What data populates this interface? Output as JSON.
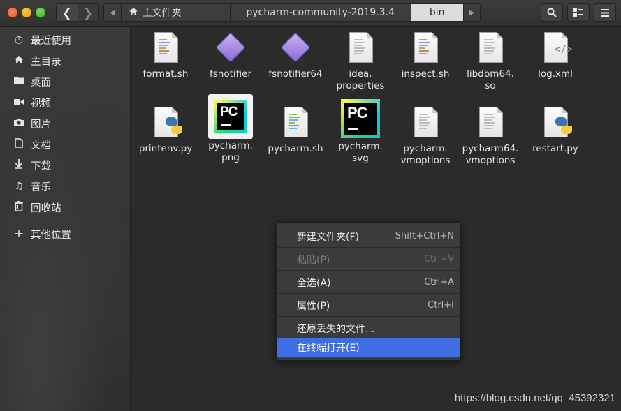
{
  "window": {
    "title": "bin"
  },
  "header": {
    "path_segments": [
      "主文件夹",
      "pycharm-community-2019.3.4",
      "bin"
    ],
    "active_segment": "bin"
  },
  "sidebar": {
    "items": [
      {
        "label": "最近使用",
        "icon": "clock-icon"
      },
      {
        "label": "主目录",
        "icon": "home-icon"
      },
      {
        "label": "桌面",
        "icon": "folder-icon"
      },
      {
        "label": "视频",
        "icon": "video-icon"
      },
      {
        "label": "图片",
        "icon": "camera-icon"
      },
      {
        "label": "文档",
        "icon": "document-icon"
      },
      {
        "label": "下载",
        "icon": "download-icon"
      },
      {
        "label": "音乐",
        "icon": "music-icon"
      },
      {
        "label": "回收站",
        "icon": "trash-icon"
      },
      {
        "label": "其他位置",
        "icon": "plus-icon"
      }
    ]
  },
  "files": [
    {
      "name": "format.sh",
      "icon": "script-icon"
    },
    {
      "name": "fsnotifier",
      "icon": "executable-icon"
    },
    {
      "name": "fsnotifier64",
      "icon": "executable-icon"
    },
    {
      "name": "idea.\nproperties",
      "icon": "text-file-icon"
    },
    {
      "name": "inspect.sh",
      "icon": "script-icon"
    },
    {
      "name": "libdbm64.\nso",
      "icon": "text-file-icon"
    },
    {
      "name": "log.xml",
      "icon": "xml-file-icon"
    },
    {
      "name": "printenv.py",
      "icon": "python-file-icon"
    },
    {
      "name": "pycharm.\npng",
      "icon": "pycharm-image-icon"
    },
    {
      "name": "pycharm.sh",
      "icon": "script-icon"
    },
    {
      "name": "pycharm.\nsvg",
      "icon": "pycharm-image-icon"
    },
    {
      "name": "pycharm.\nvmoptions",
      "icon": "text-file-icon"
    },
    {
      "name": "pycharm64.\nvmoptions",
      "icon": "text-file-icon"
    },
    {
      "name": "restart.py",
      "icon": "python-file-icon"
    }
  ],
  "context_menu": {
    "items": [
      {
        "label": "新建文件夹(F)",
        "accel": "Shift+Ctrl+N",
        "enabled": true
      },
      {
        "label": "粘贴(P)",
        "accel": "Ctrl+V",
        "enabled": false
      },
      {
        "label": "全选(A)",
        "accel": "Ctrl+A",
        "enabled": true
      },
      {
        "label": "属性(P)",
        "accel": "Ctrl+I",
        "enabled": true
      },
      {
        "label": "还原丢失的文件...",
        "accel": "",
        "enabled": true
      },
      {
        "label": "在终端打开(E)",
        "accel": "",
        "enabled": true,
        "highlighted": true
      }
    ]
  },
  "watermark": "https://blog.csdn.net/qq_45392321",
  "colors": {
    "highlight": "#3e6ee0",
    "window_close": "#e25a20",
    "window_min": "#e5a21a",
    "window_max": "#3fae2a"
  }
}
